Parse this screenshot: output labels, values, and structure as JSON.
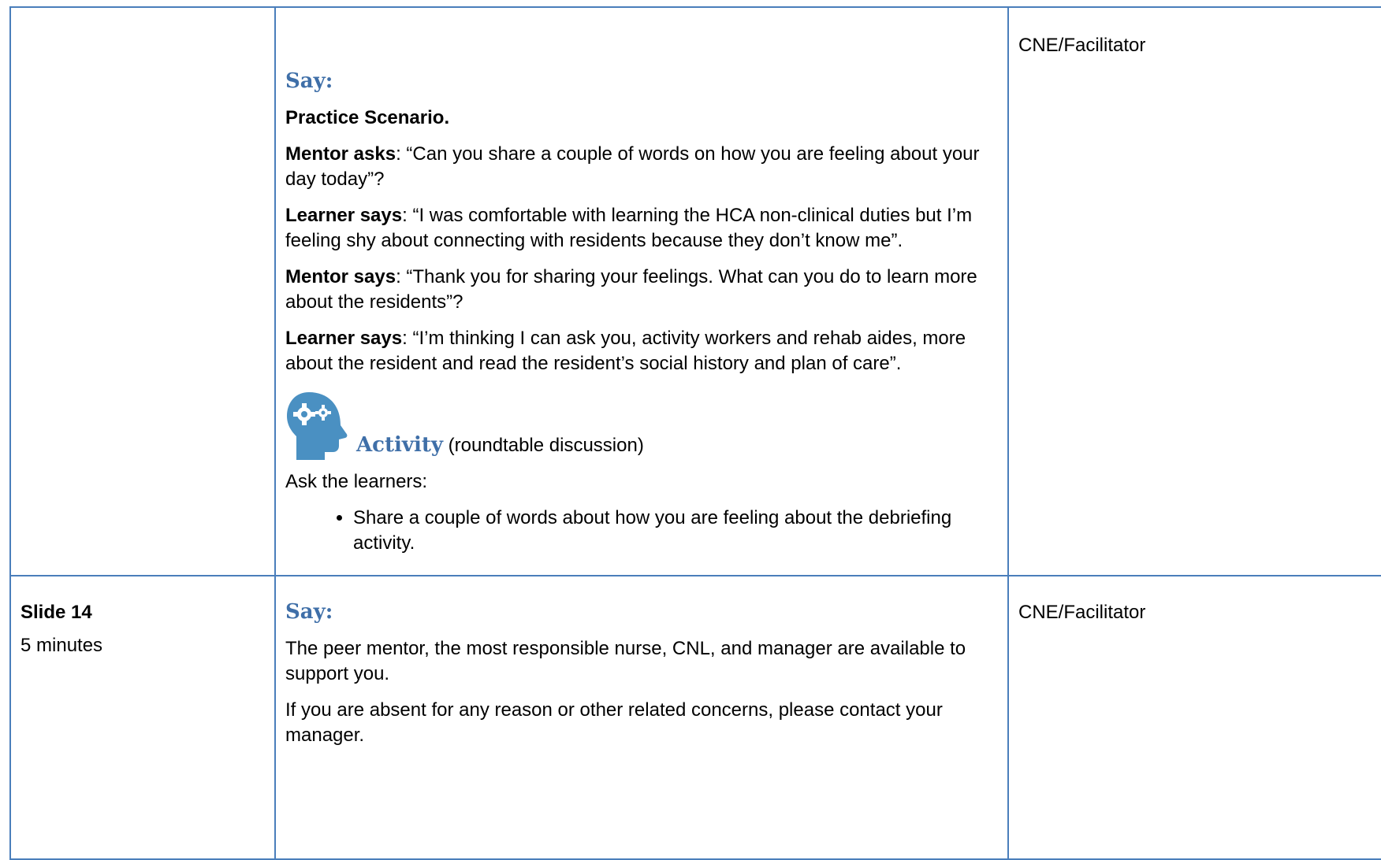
{
  "row1": {
    "col1": "",
    "say_heading": "Say:",
    "scenario_title": "Practice Scenario.",
    "exchanges": [
      {
        "speaker": "Mentor asks",
        "text": ": “Can you share a couple of words on how you are feeling about your day today”?"
      },
      {
        "speaker": "Learner says",
        "text": ": “I was comfortable with learning the HCA non-clinical duties but I’m feeling shy about connecting with residents because they don’t know me”."
      },
      {
        "speaker": "Mentor says",
        "text": ": “Thank you for sharing your feelings. What can you do to learn more about the residents”?"
      },
      {
        "speaker": "Learner says",
        "text": ": “I’m thinking I can ask you, activity workers and rehab aides, more about the resident and read the resident’s social history and plan of care”."
      }
    ],
    "activity": {
      "icon": "head-gears-icon",
      "title": "Activity",
      "subtitle": "(roundtable discussion)"
    },
    "ask_text": "Ask the learners:",
    "bullets": [
      "Share a couple of words about how you are feeling about the debriefing activity."
    ],
    "responsible": "CNE/Facilitator"
  },
  "row2": {
    "slide": "Slide 14",
    "duration": "5 minutes",
    "say_heading": "Say:",
    "paragraphs": [
      "The peer mentor, the most responsible nurse, CNL, and manager are available to support you.",
      "If you are absent for any reason or other related concerns, please contact your manager."
    ],
    "responsible": "CNE/Facilitator"
  },
  "colors": {
    "border": "#4a7ebb",
    "heading": "#3f6fa8",
    "icon": "#4a90c2"
  }
}
